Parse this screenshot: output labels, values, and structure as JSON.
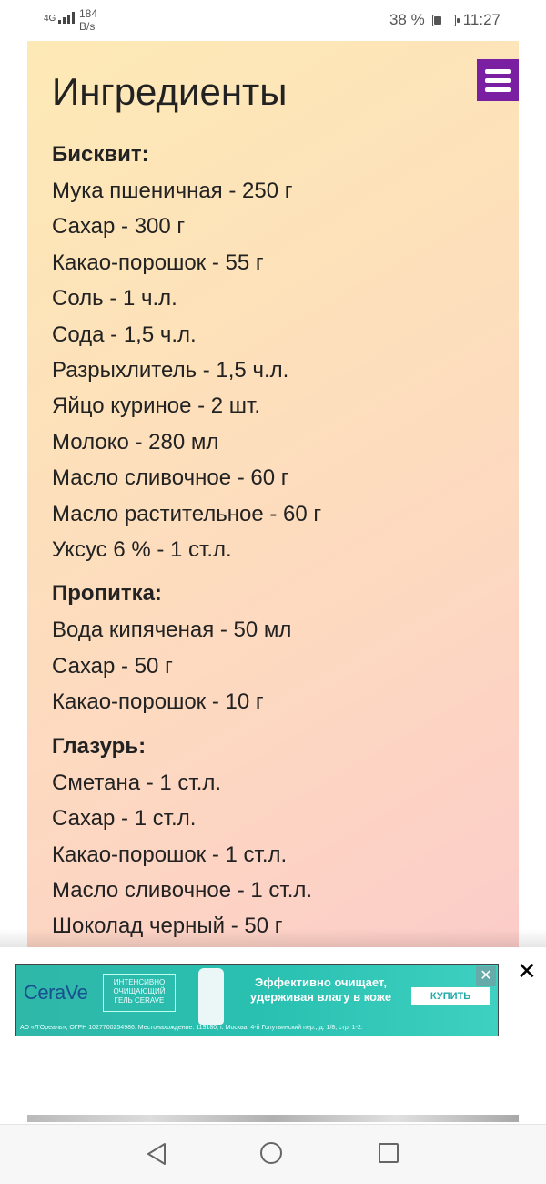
{
  "status": {
    "signal": "4G",
    "net_speed": "184",
    "net_unit": "B/s",
    "battery": "38 %",
    "battery_level": 0.38,
    "time": "11:27"
  },
  "page": {
    "title": "Ингредиенты",
    "sections": [
      {
        "title": "Бисквит:",
        "items": [
          "Мука пшеничная - 250 г",
          "Сахар - 300 г",
          "Какао-порошок - 55 г",
          "Соль - 1 ч.л.",
          "Сода - 1,5 ч.л.",
          "Разрыхлитель - 1,5 ч.л.",
          "Яйцо куриное - 2 шт.",
          "Молоко - 280 мл",
          "Масло сливочное - 60 г",
          "Масло растительное - 60 г",
          "Уксус 6 % - 1 ст.л."
        ]
      },
      {
        "title": "Пропитка:",
        "items": [
          "Вода кипяченая - 50 мл",
          "Сахар - 50 г",
          "Какао-порошок - 10 г"
        ]
      },
      {
        "title": "Глазурь:",
        "items": [
          "Сметана - 1 ст.л.",
          "Сахар - 1 ст.л.",
          "Какао-порошок - 1 ст.л.",
          "Масло сливочное - 1 ст.л.",
          "Шоколад черный - 50 г"
        ]
      }
    ]
  },
  "ad": {
    "close_label": "✕",
    "brand": "CeraVe",
    "tagline": "ИНТЕНСИВНО ОЧИЩАЮЩИЙ ГЕЛЬ CERAVE",
    "headline": "Эффективно очищает, удерживая влагу в коже",
    "cta": "КУПИТЬ",
    "legal": "АО «Л'Ореаль», ОГРН 1027700254986. Местонахождение: 119180, г. Москва, 4-й Голутвинский пер., д. 1/8, стр. 1-2.",
    "inner_close": "✕",
    "colors": {
      "banner": "#2fb7a8",
      "menu": "#7b1fa2"
    }
  },
  "nav": {
    "back_icon": "back-triangle",
    "home_icon": "home-circle",
    "recent_icon": "recent-square"
  }
}
